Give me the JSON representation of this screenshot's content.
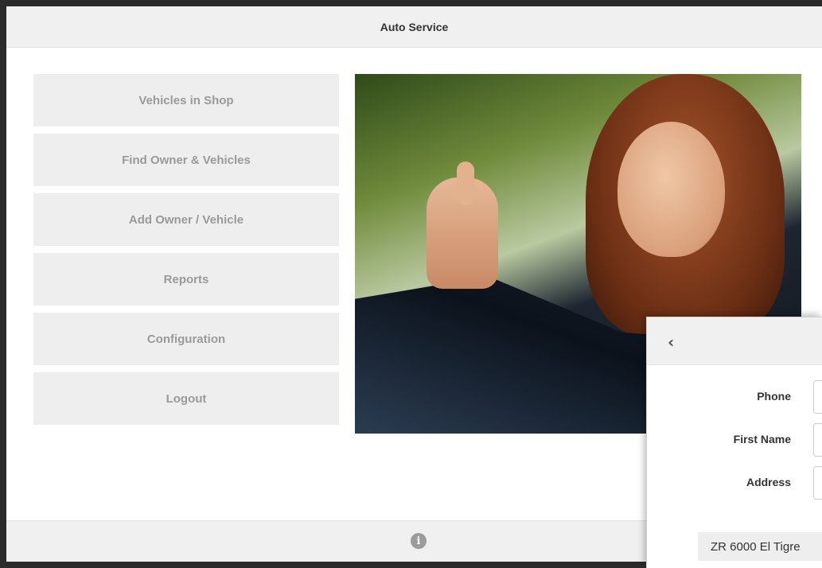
{
  "app": {
    "title": "Auto Service"
  },
  "menu": {
    "items": [
      {
        "label": "Vehicles in Shop"
      },
      {
        "label": "Find Owner & Vehicles"
      },
      {
        "label": "Add Owner / Vehicle"
      },
      {
        "label": "Reports"
      },
      {
        "label": "Configuration"
      },
      {
        "label": "Logout"
      }
    ]
  },
  "footer": {
    "icon": "info-icon",
    "icon_glyph": "i"
  },
  "panel": {
    "back_icon": "chevron-left-icon",
    "back_glyph": "‹",
    "fields": [
      {
        "label": "Phone",
        "value": ""
      },
      {
        "label": "First Name",
        "value": ""
      },
      {
        "label": "Address",
        "value": ""
      }
    ],
    "vehicle": "ZR 6000 El Tigre"
  },
  "colors": {
    "bar_bg": "#f0f0f0",
    "menu_bg": "#eeeeee",
    "menu_text": "#9a9a9a"
  }
}
